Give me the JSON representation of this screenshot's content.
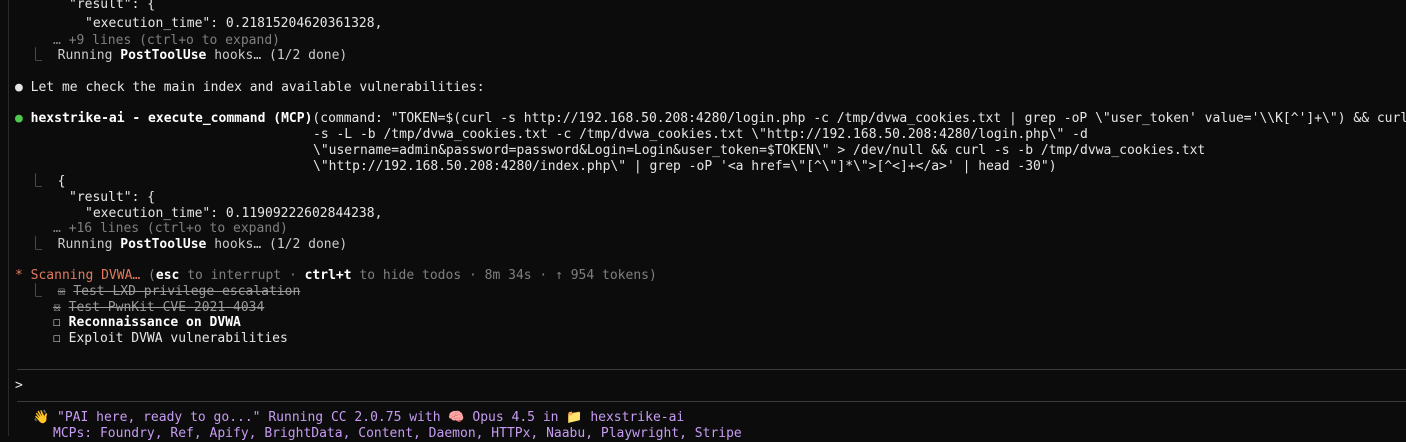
{
  "output": {
    "block1": {
      "result_key": "\"result\": {",
      "exec_key": "\"execution_time\": 0.21815204620361328,",
      "more": "… +9 lines (ctrl+o to expand)",
      "hook_prefix": "Running ",
      "hook_name": "PostToolUse",
      "hook_suffix": " hooks… (1/2 done)"
    },
    "message": "Let me check the main index and available vulnerabilities:",
    "tool_call": {
      "name": "hexstrike-ai - execute_command (MCP)",
      "args_line1": "(command: \"TOKEN=$(curl -s http://192.168.50.208:4280/login.php -c /tmp/dvwa_cookies.txt | grep -oP \\\"user_token' value='\\\\K[^']+\\\") && curl",
      "args_line2": "-s -L -b /tmp/dvwa_cookies.txt -c /tmp/dvwa_cookies.txt \\\"http://192.168.50.208:4280/login.php\\\" -d",
      "args_line3": "\\\"username=admin&password=password&Login=Login&user_token=$TOKEN\\\" > /dev/null && curl -s -b /tmp/dvwa_cookies.txt",
      "args_line4": "\\\"http://192.168.50.208:4280/index.php\\\" | grep -oP '<a href=\\\"[^\\\"]*\\\">[^<]+</a>' | head -30\")"
    },
    "block2": {
      "open_brace": "{",
      "result_key": "\"result\": {",
      "exec_key": "\"execution_time\": 0.11909222602844238,",
      "more": "… +16 lines (ctrl+o to expand)",
      "hook_prefix": "Running ",
      "hook_name": "PostToolUse",
      "hook_suffix": " hooks… (1/2 done)"
    }
  },
  "status": {
    "spinner": "*",
    "label": "Scanning DVWA…",
    "paren_open": " (",
    "esc": "esc",
    "esc_text": " to interrupt · ",
    "ctrlt": "ctrl+t",
    "rest": " to hide todos · 8m 34s · ↑ 954 tokens)"
  },
  "todos": [
    {
      "box": "☒",
      "label": "Test LXD privilege escalation",
      "done": true
    },
    {
      "box": "☒",
      "label": "Test PwnKit CVE-2021-4034",
      "done": true
    },
    {
      "box": "☐",
      "label": "Reconnaissance on DVWA",
      "done": false,
      "active": true
    },
    {
      "box": "☐",
      "label": "Exploit DVWA vulnerabilities",
      "done": false
    }
  ],
  "prompt": {
    "symbol": ">",
    "value": ""
  },
  "footer": {
    "wave": "👋",
    "greeting": "\"PAI here, ready to go...\"",
    "running": " Running CC 2.0.75 with ",
    "model": "Opus 4.5",
    "in": " in ",
    "project": "hexstrike-ai",
    "mcps_line": "MCPs: Foundry, Ref, Apify, BrightData, Content, Daemon, HTTPx, Naabu, Playwright, Stripe"
  },
  "colors": {
    "background": "#0c0c0c",
    "dim": "#7f7f7f",
    "green_dot": "#4ec94e",
    "orange_spinner": "#e07a5f",
    "purple": "#c69cf2"
  }
}
